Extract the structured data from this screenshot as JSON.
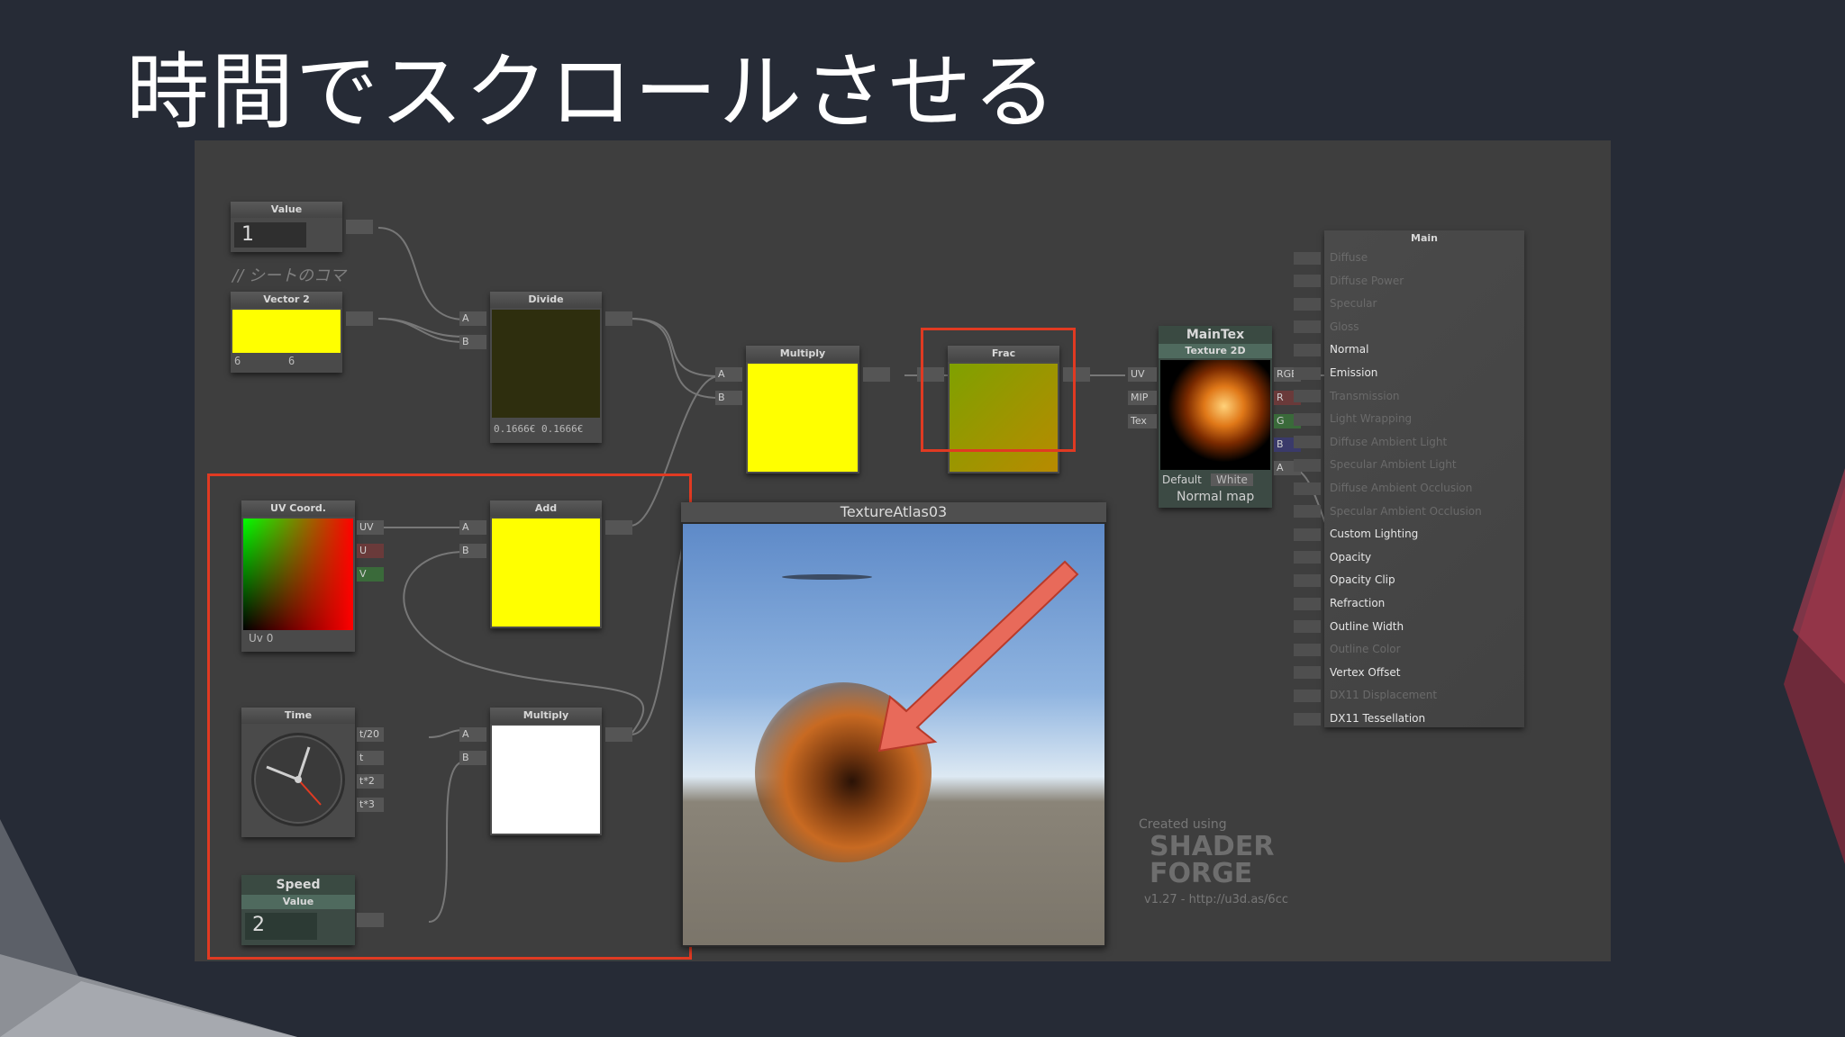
{
  "slide": {
    "title": "時間でスクロールさせる"
  },
  "nodes": {
    "value": {
      "title": "Value",
      "value": "1"
    },
    "comment": "// シートのコマ",
    "vector2": {
      "title": "Vector 2",
      "x": "6",
      "y": "6"
    },
    "divide": {
      "title": "Divide",
      "a": "A",
      "b": "B",
      "readout": "0.1666€ 0.1666€"
    },
    "multiply_top": {
      "title": "Multiply",
      "a": "A",
      "b": "B"
    },
    "frac": {
      "title": "Frac"
    },
    "maintex": {
      "title": "MainTex",
      "subtitle": "Texture 2D",
      "inputs": [
        "UV",
        "MIP",
        "Tex"
      ],
      "outputs": [
        "RGB",
        "R",
        "G",
        "B",
        "A"
      ],
      "mode": "Default",
      "default_color": "White",
      "normal_map": "Normal map"
    },
    "uvcoord": {
      "title": "UV Coord.",
      "outputs": [
        "UV",
        "U",
        "V"
      ],
      "channel": "Uv 0"
    },
    "add": {
      "title": "Add",
      "a": "A",
      "b": "B"
    },
    "time": {
      "title": "Time",
      "outputs": [
        "t/20",
        "t",
        "t*2",
        "t*3"
      ]
    },
    "multiply_bottom": {
      "title": "Multiply",
      "a": "A",
      "b": "B"
    },
    "speed": {
      "title": "Speed",
      "subtitle": "Value",
      "value": "2"
    }
  },
  "preview": {
    "title": "TextureAtlas03"
  },
  "main_panel": {
    "title": "Main",
    "items": [
      {
        "label": "Diffuse",
        "active": false
      },
      {
        "label": "Diffuse Power",
        "active": false
      },
      {
        "label": "Specular",
        "active": false
      },
      {
        "label": "Gloss",
        "active": false
      },
      {
        "label": "Normal",
        "active": true
      },
      {
        "label": "Emission",
        "active": true
      },
      {
        "label": "Transmission",
        "active": false
      },
      {
        "label": "Light Wrapping",
        "active": false
      },
      {
        "label": "Diffuse Ambient Light",
        "active": false
      },
      {
        "label": "Specular Ambient Light",
        "active": false
      },
      {
        "label": "Diffuse Ambient Occlusion",
        "active": false
      },
      {
        "label": "Specular Ambient Occlusion",
        "active": false
      },
      {
        "label": "Custom Lighting",
        "active": true
      },
      {
        "label": "Opacity",
        "active": true
      },
      {
        "label": "Opacity Clip",
        "active": true
      },
      {
        "label": "Refraction",
        "active": true
      },
      {
        "label": "Outline Width",
        "active": true
      },
      {
        "label": "Outline Color",
        "active": false
      },
      {
        "label": "Vertex Offset",
        "active": true
      },
      {
        "label": "DX11 Displacement",
        "active": false
      },
      {
        "label": "DX11 Tessellation",
        "active": true
      }
    ]
  },
  "shaderforge": {
    "created": "Created using",
    "logo": "SHADER FORGE",
    "version": "v1.27 - http://u3d.as/6cc"
  },
  "colors": {
    "highlight": "#e03a22",
    "yellow": "#ffff00",
    "canvas": "#3e3e3e",
    "background": "#262b36"
  }
}
